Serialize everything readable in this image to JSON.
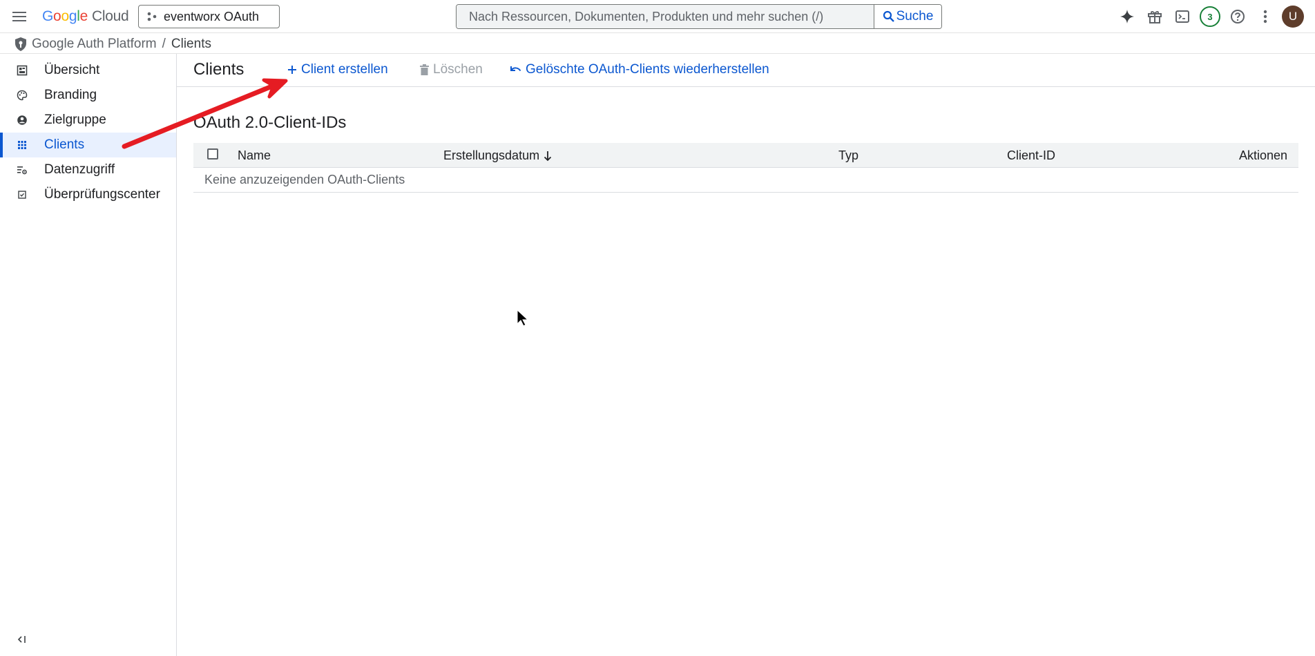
{
  "app": {
    "logo_letters": [
      "G",
      "o",
      "o",
      "g",
      "l",
      "e"
    ],
    "logo_suffix": "Cloud"
  },
  "project": {
    "name": "eventworx OAuth"
  },
  "search": {
    "placeholder": "Nach Ressourcen, Dokumenten, Produkten und mehr suchen (/)",
    "button_label": "Suche"
  },
  "topicons": {
    "notifications_count": "3",
    "avatar_initial": "U"
  },
  "breadcrumb": {
    "root": "Google Auth Platform",
    "separator": "/",
    "current": "Clients"
  },
  "sidebar": {
    "items": [
      {
        "label": "Übersicht",
        "icon": "dashboard-icon"
      },
      {
        "label": "Branding",
        "icon": "palette-icon"
      },
      {
        "label": "Zielgruppe",
        "icon": "person-icon"
      },
      {
        "label": "Clients",
        "icon": "apps-grid-icon",
        "active": true
      },
      {
        "label": "Datenzugriff",
        "icon": "data-access-icon"
      },
      {
        "label": "Überprüfungscenter",
        "icon": "verification-icon"
      }
    ]
  },
  "page": {
    "title": "Clients",
    "actions": {
      "create": "Client erstellen",
      "delete": "Löschen",
      "restore": "Gelöschte OAuth-Clients wiederherstellen"
    },
    "section_title": "OAuth 2.0-Client-IDs"
  },
  "table": {
    "columns": [
      "Name",
      "Erstellungsdatum",
      "Typ",
      "Client-ID",
      "Aktionen"
    ],
    "sort_column": "Erstellungsdatum",
    "sort_direction": "descending",
    "empty_message": "Keine anzuzeigenden OAuth-Clients"
  },
  "colors": {
    "accent": "#0b57d0",
    "active_bg": "#e8f0fe",
    "annotation_arrow": "#e51c23"
  }
}
